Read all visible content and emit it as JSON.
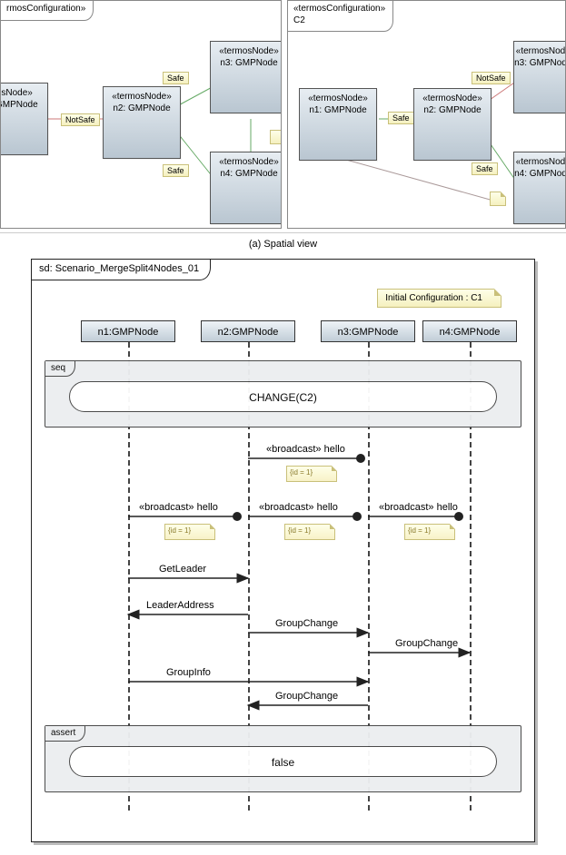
{
  "spatial": {
    "left": {
      "title_line1": "rmosConfiguration»",
      "title_line2": ""
    },
    "right": {
      "title_line1": "«termosConfiguration»",
      "title_line2": "C2"
    },
    "nodes": {
      "n1": {
        "stereo": "«termosNode»",
        "name_partial": "rmosNode»",
        "label": "n1: GMPNode"
      },
      "n2": {
        "stereo": "«termosNode»",
        "label": "n2: GMPNode"
      },
      "n3": {
        "stereo": "«termosNode»",
        "label": "n3: GMPNode",
        "stereo_partial": "«termosNod",
        "label_partial": "n3: GMPNod"
      },
      "n4": {
        "stereo": "«termosNode»",
        "label": "n4: GMPNode",
        "stereo_partial": "«termosNod",
        "label_partial": "n4: GMPNod"
      }
    },
    "tags": {
      "safe": "Safe",
      "notsafe": "NotSafe"
    },
    "caption": "(a) Spatial view"
  },
  "sequence": {
    "frame_title": "sd: Scenario_MergeSplit4Nodes_01",
    "initial_note": "Initial Configuration : C1",
    "lifelines": {
      "n1": "n1:GMPNode",
      "n2": "n2:GMPNode",
      "n3": "n3:GMPNode",
      "n4": "n4:GMPNode"
    },
    "fragments": {
      "seq_label": "seq",
      "assert_label": "assert",
      "change_text": "CHANGE(C2)",
      "assert_text": "false"
    },
    "messages": {
      "hello": "«broadcast»  hello",
      "id_note": "{id = 1}",
      "get_leader": "GetLeader",
      "leader_address": "LeaderAddress",
      "group_change": "GroupChange",
      "group_info": "GroupInfo"
    }
  }
}
